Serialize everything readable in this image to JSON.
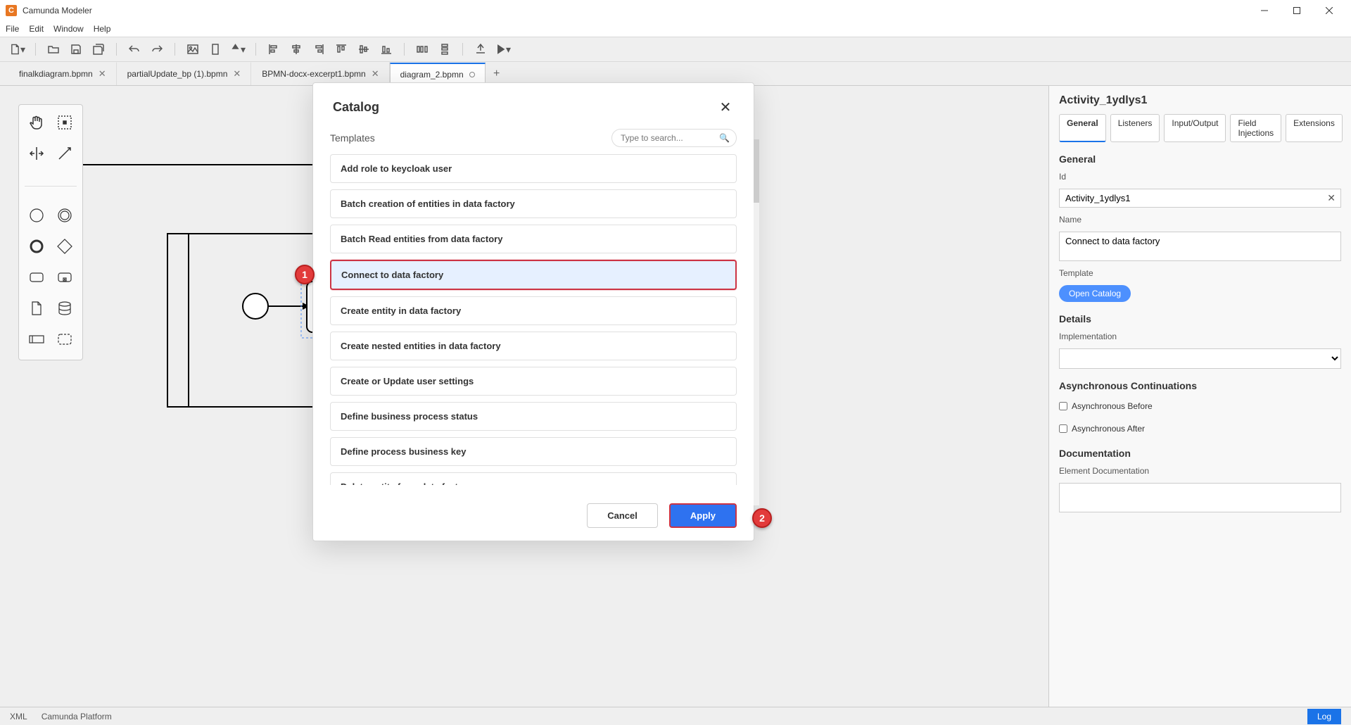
{
  "app": {
    "title": "Camunda Modeler"
  },
  "menu": {
    "items": [
      "File",
      "Edit",
      "Window",
      "Help"
    ]
  },
  "toolbar_icons": [
    "new-file-icon",
    "open-file-icon",
    "save-icon",
    "save-all-icon",
    "sep",
    "undo-icon",
    "redo-icon",
    "sep",
    "image-icon",
    "portrait-icon",
    "color-icon",
    "sep",
    "align-left-icon",
    "align-hcenter-icon",
    "align-right-icon",
    "align-top-icon",
    "align-vcenter-icon",
    "align-bottom-icon",
    "sep",
    "distribute-h-icon",
    "distribute-v-icon",
    "sep",
    "deploy-icon",
    "run-icon"
  ],
  "tabs": [
    {
      "label": "finalkdiagram.bpmn",
      "closable": true,
      "active": false
    },
    {
      "label": "partialUpdate_bp (1).bpmn",
      "closable": true,
      "active": false
    },
    {
      "label": "BPMN-docx-excerpt1.bpmn",
      "closable": true,
      "active": false
    },
    {
      "label": "diagram_2.bpmn",
      "dirty": true,
      "active": true
    }
  ],
  "modal": {
    "title": "Catalog",
    "templates_label": "Templates",
    "search_placeholder": "Type to search...",
    "items": [
      "Add role to keycloak user",
      "Batch creation of entities in data factory",
      "Batch Read entities from data factory",
      "Connect to data factory",
      "Create entity in data factory",
      "Create nested entities in data factory",
      "Create or Update user settings",
      "Define business process status",
      "Define process business key",
      "Delete entity from data factory"
    ],
    "selected_index": 3,
    "cancel": "Cancel",
    "apply": "Apply"
  },
  "annotations": {
    "badge1": "1",
    "badge2": "2"
  },
  "props": {
    "title": "Activity_1ydlys1",
    "tabs": [
      "General",
      "Listeners",
      "Input/Output",
      "Field Injections",
      "Extensions"
    ],
    "section_general": "General",
    "id_label": "Id",
    "id_value": "Activity_1ydlys1",
    "name_label": "Name",
    "name_value": "Connect to data factory",
    "template_label": "Template",
    "open_catalog": "Open Catalog",
    "section_details": "Details",
    "impl_label": "Implementation",
    "section_async": "Asynchronous Continuations",
    "async_before": "Asynchronous Before",
    "async_after": "Asynchronous After",
    "section_doc": "Documentation",
    "doc_label": "Element Documentation"
  },
  "status": {
    "left1": "XML",
    "left2": "Camunda Platform",
    "log": "Log"
  },
  "colors": {
    "accent": "#1a73e8",
    "annotation": "#e23b3b"
  }
}
